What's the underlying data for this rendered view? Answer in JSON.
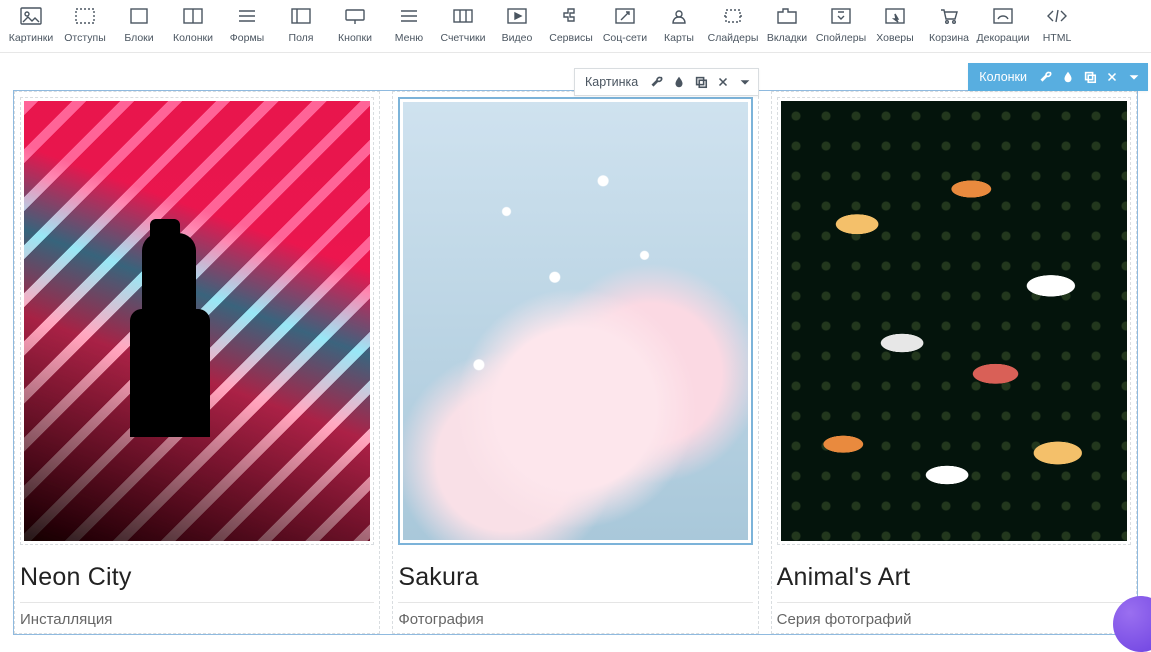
{
  "toolbar": {
    "items": [
      {
        "id": "pictures",
        "label": "Картинки"
      },
      {
        "id": "paddings",
        "label": "Отступы"
      },
      {
        "id": "blocks",
        "label": "Блоки"
      },
      {
        "id": "columns",
        "label": "Колонки"
      },
      {
        "id": "forms",
        "label": "Формы"
      },
      {
        "id": "fields",
        "label": "Поля"
      },
      {
        "id": "buttons",
        "label": "Кнопки"
      },
      {
        "id": "menu",
        "label": "Меню"
      },
      {
        "id": "counters",
        "label": "Счетчики"
      },
      {
        "id": "video",
        "label": "Видео"
      },
      {
        "id": "services",
        "label": "Сервисы"
      },
      {
        "id": "social",
        "label": "Соц-сети"
      },
      {
        "id": "maps",
        "label": "Карты"
      },
      {
        "id": "sliders",
        "label": "Слайдеры"
      },
      {
        "id": "tabs",
        "label": "Вкладки"
      },
      {
        "id": "spoilers",
        "label": "Спойлеры"
      },
      {
        "id": "hovers",
        "label": "Ховеры"
      },
      {
        "id": "cart",
        "label": "Корзина"
      },
      {
        "id": "decorations",
        "label": "Декорации"
      },
      {
        "id": "html",
        "label": "HTML"
      }
    ]
  },
  "element_controls": {
    "image": {
      "label": "Картинка"
    },
    "columns": {
      "label": "Колонки"
    }
  },
  "cards": [
    {
      "title": "Neon City",
      "subtitle": "Инсталляция"
    },
    {
      "title": "Sakura",
      "subtitle": "Фотография"
    },
    {
      "title": "Animal's Art",
      "subtitle": "Серия фотографий"
    }
  ]
}
